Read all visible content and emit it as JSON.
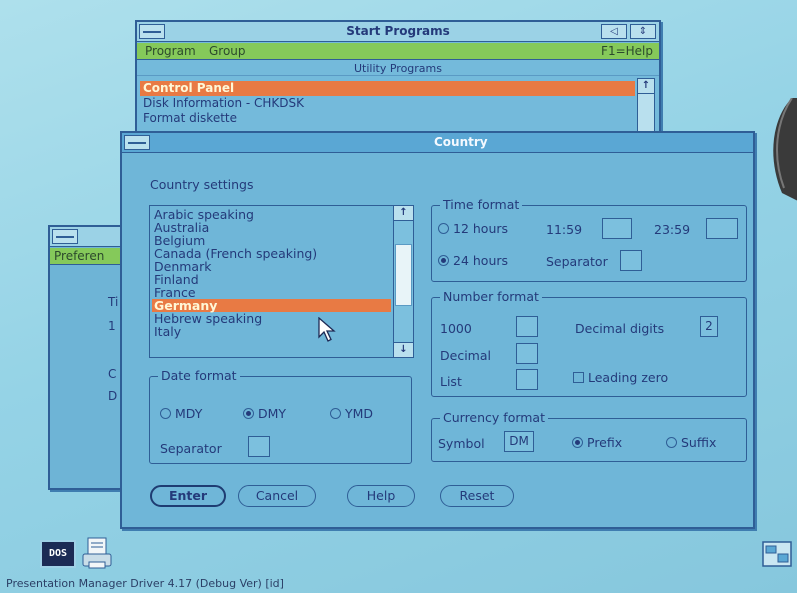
{
  "start_programs": {
    "title": "Start Programs",
    "menu": {
      "program": "Program",
      "group": "Group",
      "help": "F1=Help"
    },
    "group_title": "Utility Programs",
    "items": [
      "Control Panel",
      "Disk Information - CHKDSK",
      "Format diskette"
    ],
    "selected_index": 0
  },
  "preferences": {
    "menu_fragment": "Preferen",
    "fragments": [
      "Ti",
      "1",
      "C",
      "D"
    ]
  },
  "country": {
    "title": "Country",
    "settings_label": "Country settings",
    "countries": [
      "Arabic speaking",
      "Australia",
      "Belgium",
      "Canada (French speaking)",
      "Denmark",
      "Finland",
      "France",
      "Germany",
      "Hebrew speaking",
      "Italy"
    ],
    "selected_country": "Germany",
    "date_format": {
      "legend": "Date format",
      "options": [
        "MDY",
        "DMY",
        "YMD"
      ],
      "selected": "DMY",
      "separator_label": "Separator",
      "separator_value": ""
    },
    "time_format": {
      "legend": "Time format",
      "option_12": "12 hours",
      "option_24": "24 hours",
      "selected": "24 hours",
      "am_label": "11:59",
      "am_value": "",
      "pm_label": "23:59",
      "pm_value": "",
      "separator_label": "Separator",
      "separator_value": ""
    },
    "number_format": {
      "legend": "Number format",
      "thousand_label": "1000",
      "thousand_value": "",
      "decimal_label": "Decimal",
      "decimal_value": "",
      "list_label": "List",
      "list_value": "",
      "decimal_digits_label": "Decimal digits",
      "decimal_digits_value": "2",
      "leading_zero_label": "Leading zero",
      "leading_zero_checked": false
    },
    "currency_format": {
      "legend": "Currency format",
      "symbol_label": "Symbol",
      "symbol_value": "DM",
      "options": [
        "Prefix",
        "Suffix"
      ],
      "selected": "Prefix"
    },
    "buttons": {
      "enter": "Enter",
      "cancel": "Cancel",
      "help": "Help",
      "reset": "Reset"
    }
  },
  "desktop": {
    "dos_icon_label": "DOS",
    "status_text": "Presentation Manager Driver 4.17 (Debug Ver) [id]"
  },
  "colors": {
    "selection": "#e87a44",
    "menubar": "#85c95a",
    "window_body": "#6fb6d8",
    "text": "#243a7a"
  }
}
